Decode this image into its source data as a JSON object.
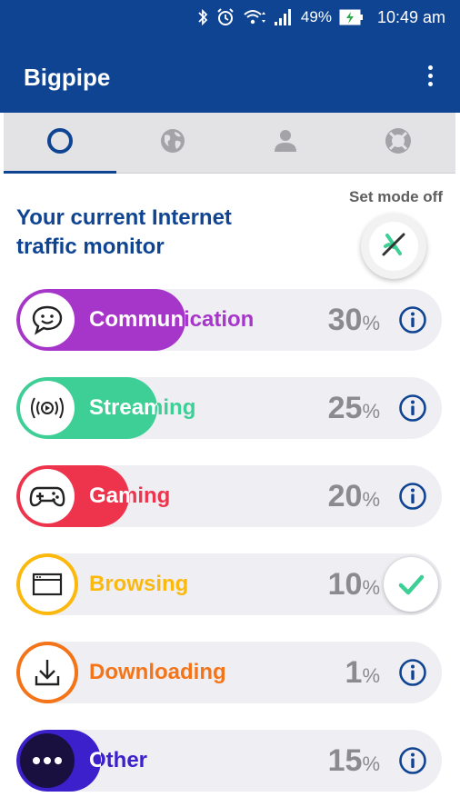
{
  "status_bar": {
    "battery": "49%",
    "time": "10:49 am"
  },
  "app": {
    "title": "Bigpipe"
  },
  "tabs": [
    {
      "id": "monitor",
      "icon": "circle-icon",
      "active": true
    },
    {
      "id": "globe",
      "icon": "globe-icon",
      "active": false
    },
    {
      "id": "account",
      "icon": "person-icon",
      "active": false
    },
    {
      "id": "help",
      "icon": "lifebuoy-icon",
      "active": false
    }
  ],
  "monitor": {
    "title_line1": "Your current Internet",
    "title_line2": "traffic monitor",
    "mode_label": "Set mode off"
  },
  "categories": [
    {
      "label": "Communication",
      "percent": "30",
      "level": 30,
      "color": "#a536c9",
      "icon": "chat-bubble-icon",
      "action": "info"
    },
    {
      "label": "Streaming",
      "percent": "25",
      "level": 25,
      "color": "#3dcf95",
      "icon": "broadcast-icon",
      "action": "info"
    },
    {
      "label": "Gaming",
      "percent": "20",
      "level": 20,
      "color": "#ee344c",
      "icon": "gamepad-icon",
      "action": "info"
    },
    {
      "label": "Browsing",
      "percent": "10",
      "level": 10,
      "color": "#fbb80d",
      "icon": "browser-window-icon",
      "action": "selected"
    },
    {
      "label": "Downloading",
      "percent": "1",
      "level": 1,
      "color": "#f47519",
      "icon": "download-icon",
      "action": "info"
    },
    {
      "label": "Other",
      "percent": "15",
      "level": 15,
      "color": "#3b20cb",
      "icon": "more-dots-icon",
      "action": "info"
    }
  ],
  "percent_symbol": "%",
  "colors": {
    "primary": "#0f4492",
    "track": "#efeef3",
    "check": "#3dcf95"
  }
}
